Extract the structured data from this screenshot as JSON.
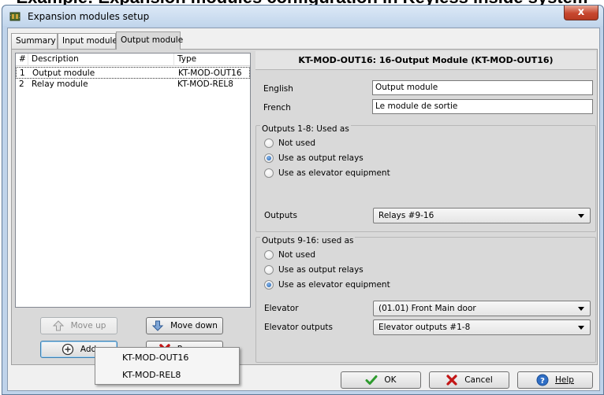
{
  "caption": "Example: Expansion modules configuration in Keyless inside system",
  "window": {
    "title": "Expansion modules setup",
    "close_glyph": "x"
  },
  "tabs": [
    {
      "label": "Summary",
      "active": false
    },
    {
      "label": "Input module",
      "active": false
    },
    {
      "label": "Output module",
      "active": true
    }
  ],
  "modules_list": {
    "columns": [
      "#",
      "Description",
      "Type"
    ],
    "rows": [
      {
        "num": "1",
        "description": "Output module",
        "type": "KT-MOD-OUT16",
        "selected": true
      },
      {
        "num": "2",
        "description": "Relay module",
        "type": "KT-MOD-REL8",
        "selected": false
      }
    ]
  },
  "list_buttons": {
    "move_up": "Move up",
    "move_down": "Move down",
    "add": "Add",
    "remove": "Remove"
  },
  "module_header": "KT-MOD-OUT16: 16-Output Module (KT-MOD-OUT16)",
  "names": {
    "english_label": "English",
    "english_value": "Output module",
    "french_label": "French",
    "french_value": "Le module de sortie"
  },
  "outputs_1_8": {
    "title": "Outputs 1-8: Used as",
    "options": [
      "Not used",
      "Use as output relays",
      "Use as elevator equipment"
    ],
    "selected_index": 1,
    "outputs_label": "Outputs",
    "outputs_value": "Relays #9-16"
  },
  "outputs_9_16": {
    "title": "Outputs 9-16: used as",
    "options": [
      "Not used",
      "Use as output relays",
      "Use as elevator equipment"
    ],
    "selected_index": 2,
    "elevator_label": "Elevator",
    "elevator_value": "(01.01) Front Main door",
    "elevator_outputs_label": "Elevator outputs",
    "elevator_outputs_value": "Elevator outputs #1-8"
  },
  "dialog_buttons": {
    "ok": "OK",
    "cancel": "Cancel",
    "help": "Help"
  },
  "add_menu": {
    "items": [
      "KT-MOD-OUT16",
      "KT-MOD-REL8"
    ]
  },
  "colors": {
    "window_frame": "#bfd3ea",
    "panel": "#d9d9d9",
    "close_button": "#c7472f",
    "radio_checked": "#1c5fb1"
  }
}
